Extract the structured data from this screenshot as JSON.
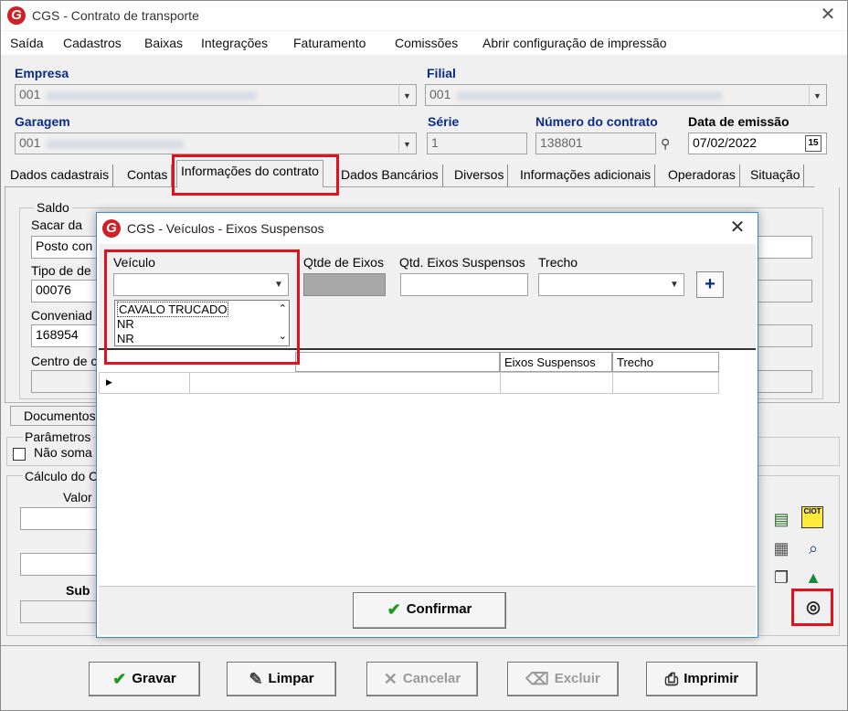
{
  "window": {
    "title": "CGS - Contrato de transporte",
    "logo_letter": "G"
  },
  "menu": [
    "Saída",
    "Cadastros",
    "Baixas",
    "Integrações",
    "Faturamento",
    "Comissões",
    "Abrir configuração de impressão"
  ],
  "header": {
    "empresa_label": "Empresa",
    "empresa_value": "001",
    "filial_label": "Filial",
    "filial_value": "001",
    "garagem_label": "Garagem",
    "garagem_value": "001",
    "serie_label": "Série",
    "serie_value": "1",
    "numero_label": "Número do contrato",
    "numero_value": "138801",
    "data_label": "Data de emissão",
    "data_value": "07/02/2022",
    "calendar_badge": "15"
  },
  "tabs": [
    "Dados cadastrais",
    "Contas",
    "Informações do contrato",
    "Dados Bancários",
    "Diversos",
    "Informações adicionais",
    "Operadoras",
    "Situação"
  ],
  "background_form": {
    "saldo_group": "Saldo",
    "sacar_label": "Sacar da",
    "sacar_value": "Posto con",
    "tipo_label": "Tipo de de",
    "tipo_value": "00076",
    "conveniado_label": "Conveniad",
    "conveniado_value": "168954",
    "centro_label": "Centro de c",
    "documentos_tab": "Documentos",
    "parametros_group": "Parâmetros",
    "nao_somar_label": "Não soma",
    "calculo_group": "Cálculo do C",
    "valor_label": "Valor",
    "subtotal_label": "Sub"
  },
  "modal": {
    "title": "CGS - Veículos - Eixos Suspensos",
    "veiculo_label": "Veículo",
    "veiculo_value": "",
    "qtde_eixos_label": "Qtde de Eixos",
    "qtd_suspensos_label": "Qtd. Eixos Suspensos",
    "trecho_label": "Trecho",
    "add_button": "+",
    "dropdown_options": [
      "CAVALO TRUCADO",
      "NR",
      "NR"
    ],
    "grid_headers": [
      "Eixos Suspensos",
      "Trecho"
    ],
    "confirm_label": "Confirmar"
  },
  "side_icons": [
    "document-icon",
    "ciot-icon",
    "invoice-icon",
    "search-doc-icon",
    "files-icon",
    "drive-icon",
    "tire-icon"
  ],
  "ciot_text": "CIOT",
  "footer": {
    "gravar": "Gravar",
    "limpar": "Limpar",
    "cancelar": "Cancelar",
    "excluir": "Excluir",
    "imprimir": "Imprimir"
  },
  "colors": {
    "highlight_red": "#e3111b",
    "label_blue": "#0a2c86",
    "logo_red": "#d21f26",
    "modal_border": "#3a8ddb"
  }
}
